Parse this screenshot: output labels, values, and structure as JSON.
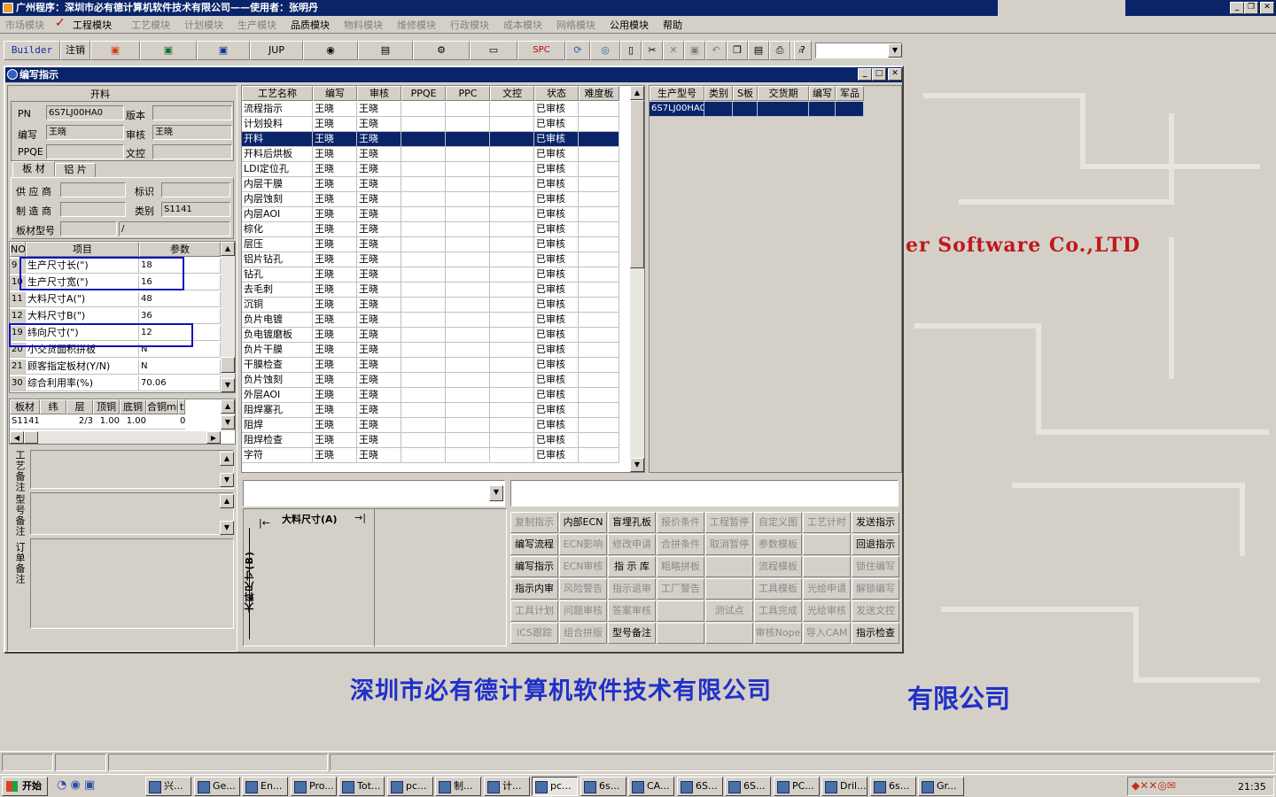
{
  "app": {
    "title": "广州程序：深圳市必有德计算机软件技术有限公司——使用者：张明丹"
  },
  "menu": [
    "市场模块",
    "工程模块",
    "工艺模块",
    "计划模块",
    "生产模块",
    "品质模块",
    "物料模块",
    "维修模块",
    "行政模块",
    "成本模块",
    "网络模块",
    "公用模块",
    "帮助"
  ],
  "toolbar": {
    "builder": "Builder",
    "logout": "注销",
    "jup": "JUP",
    "spc": "SPC"
  },
  "desktop": {
    "banner_red": "er Software Co.,LTD",
    "banner_blue": "深圳市必有德计算机软件技术有限公司",
    "banner_blue2": "有限公司"
  },
  "window": {
    "title": "编写指示"
  },
  "left": {
    "process_name": "开料",
    "pn_label": "PN",
    "pn_value": "6S7LJ00HA0",
    "version_label": "版本",
    "version_value": "",
    "writer_label": "编写",
    "writer_value": "王晓",
    "reviewer_label": "审核",
    "reviewer_value": "王晓",
    "ppqe_label": "PPQE",
    "ppqe_value": "",
    "doc_label": "文控",
    "doc_value": "",
    "tab_board": "板 材",
    "tab_foil": "铝 片",
    "supplier_label": "供 应 商",
    "supplier_value": "",
    "mark_label": "标识",
    "mark_value": "",
    "maker_label": "制 造 商",
    "maker_value": "",
    "type_label": "类别",
    "type_value": "S1141",
    "model_label": "板材型号",
    "model_value": "",
    "model_value2": "/",
    "params_headers": [
      "NO",
      "项目",
      "参数"
    ],
    "params": [
      {
        "no": "9",
        "item": "生产尺寸长(\")",
        "val": "18"
      },
      {
        "no": "10",
        "item": "生产尺寸宽(\")",
        "val": "16"
      },
      {
        "no": "11",
        "item": "大料尺寸A(\")",
        "val": "48"
      },
      {
        "no": "12",
        "item": "大料尺寸B(\")",
        "val": "36"
      },
      {
        "no": "19",
        "item": "纬向尺寸(\")",
        "val": "12"
      },
      {
        "no": "20",
        "item": "小交货面积拼板",
        "val": "N"
      },
      {
        "no": "21",
        "item": "顾客指定板材(Y/N)",
        "val": "N"
      },
      {
        "no": "30",
        "item": "综合利用率(%)",
        "val": "70.06"
      }
    ],
    "mat_headers": [
      "板材",
      "纬",
      "层",
      "顶铜",
      "底铜",
      "合铜mm",
      "t"
    ],
    "mat_row": [
      "S1141",
      "",
      "2/3",
      "1.00",
      "1.00",
      "",
      "0"
    ],
    "note1": "工艺备注",
    "note2": "型号备注",
    "note3": "订单备注"
  },
  "process": {
    "headers": [
      "工艺名称",
      "编写",
      "审核",
      "PPQE",
      "PPC",
      "文控",
      "状态",
      "难度板"
    ],
    "rows": [
      [
        "流程指示",
        "王晓",
        "王晓",
        "",
        "",
        "",
        "已审核",
        ""
      ],
      [
        "计划投料",
        "王晓",
        "王晓",
        "",
        "",
        "",
        "已审核",
        ""
      ],
      [
        "开料",
        "王晓",
        "王晓",
        "",
        "",
        "",
        "已审核",
        ""
      ],
      [
        "开料后烘板",
        "王晓",
        "王晓",
        "",
        "",
        "",
        "已审核",
        ""
      ],
      [
        "LDI定位孔",
        "王晓",
        "王晓",
        "",
        "",
        "",
        "已审核",
        ""
      ],
      [
        "内层干膜",
        "王晓",
        "王晓",
        "",
        "",
        "",
        "已审核",
        ""
      ],
      [
        "内层蚀刻",
        "王晓",
        "王晓",
        "",
        "",
        "",
        "已审核",
        ""
      ],
      [
        "内层AOI",
        "王晓",
        "王晓",
        "",
        "",
        "",
        "已审核",
        ""
      ],
      [
        "棕化",
        "王晓",
        "王晓",
        "",
        "",
        "",
        "已审核",
        ""
      ],
      [
        "层压",
        "王晓",
        "王晓",
        "",
        "",
        "",
        "已审核",
        ""
      ],
      [
        "铝片钻孔",
        "王晓",
        "王晓",
        "",
        "",
        "",
        "已审核",
        ""
      ],
      [
        "钻孔",
        "王晓",
        "王晓",
        "",
        "",
        "",
        "已审核",
        ""
      ],
      [
        "去毛刺",
        "王晓",
        "王晓",
        "",
        "",
        "",
        "已审核",
        ""
      ],
      [
        "沉铜",
        "王晓",
        "王晓",
        "",
        "",
        "",
        "已审核",
        ""
      ],
      [
        "负片电镀",
        "王晓",
        "王晓",
        "",
        "",
        "",
        "已审核",
        ""
      ],
      [
        "负电镀磨板",
        "王晓",
        "王晓",
        "",
        "",
        "",
        "已审核",
        ""
      ],
      [
        "负片干膜",
        "王晓",
        "王晓",
        "",
        "",
        "",
        "已审核",
        ""
      ],
      [
        "干膜检查",
        "王晓",
        "王晓",
        "",
        "",
        "",
        "已审核",
        ""
      ],
      [
        "负片蚀刻",
        "王晓",
        "王晓",
        "",
        "",
        "",
        "已审核",
        ""
      ],
      [
        "外层AOI",
        "王晓",
        "王晓",
        "",
        "",
        "",
        "已审核",
        ""
      ],
      [
        "阻焊塞孔",
        "王晓",
        "王晓",
        "",
        "",
        "",
        "已审核",
        ""
      ],
      [
        "阻焊",
        "王晓",
        "王晓",
        "",
        "",
        "",
        "已审核",
        ""
      ],
      [
        "阻焊检查",
        "王晓",
        "王晓",
        "",
        "",
        "",
        "已审核",
        ""
      ],
      [
        "字符",
        "王晓",
        "王晓",
        "",
        "",
        "",
        "已审核",
        ""
      ]
    ],
    "selected": 2
  },
  "right": {
    "headers": [
      "生产型号",
      "类别",
      "S板",
      "交货期",
      "编写",
      "军品"
    ],
    "row": [
      "6S7LJ00HA0",
      "",
      "",
      "",
      "",
      ""
    ]
  },
  "diagram": {
    "a_label": "大料尺寸(A)",
    "b_label": "大料尺寸(B)"
  },
  "actions": [
    [
      {
        "t": "复制指示",
        "d": true
      },
      {
        "t": "内部ECN",
        "d": false
      },
      {
        "t": "盲埋孔板",
        "d": false
      },
      {
        "t": "报价条件",
        "d": true
      },
      {
        "t": "工程暂停",
        "d": true
      },
      {
        "t": "自定义图",
        "d": true
      },
      {
        "t": "工艺计时",
        "d": true
      },
      {
        "t": "发送指示",
        "d": false
      }
    ],
    [
      {
        "t": "编写流程",
        "d": false
      },
      {
        "t": "ECN影响",
        "d": true
      },
      {
        "t": "修改申请",
        "d": true
      },
      {
        "t": "合拼条件",
        "d": true
      },
      {
        "t": "取消暂停",
        "d": true
      },
      {
        "t": "参数模板",
        "d": true
      },
      {
        "t": "",
        "d": true
      },
      {
        "t": "回退指示",
        "d": false
      }
    ],
    [
      {
        "t": "编写指示",
        "d": false
      },
      {
        "t": "ECN审核",
        "d": true
      },
      {
        "t": "指 示 库",
        "d": false
      },
      {
        "t": "粗略拼板",
        "d": true
      },
      {
        "t": "",
        "d": true
      },
      {
        "t": "流程模板",
        "d": true
      },
      {
        "t": "",
        "d": true
      },
      {
        "t": "锁住编写",
        "d": true
      }
    ],
    [
      {
        "t": "指示内审",
        "d": false
      },
      {
        "t": "风险警告",
        "d": true
      },
      {
        "t": "指示退审",
        "d": true
      },
      {
        "t": "工厂警告",
        "d": true
      },
      {
        "t": "",
        "d": true
      },
      {
        "t": "工具模板",
        "d": true
      },
      {
        "t": "光绘申请",
        "d": true
      },
      {
        "t": "解锁编写",
        "d": true
      }
    ],
    [
      {
        "t": "工具计划",
        "d": true
      },
      {
        "t": "问题审核",
        "d": true
      },
      {
        "t": "答案审核",
        "d": true
      },
      {
        "t": "",
        "d": true
      },
      {
        "t": "测试点",
        "d": true
      },
      {
        "t": "工具完成",
        "d": true
      },
      {
        "t": "光绘审核",
        "d": true
      },
      {
        "t": "发送文控",
        "d": true
      }
    ],
    [
      {
        "t": "ICS跟踪",
        "d": true
      },
      {
        "t": "组合拼版",
        "d": true
      },
      {
        "t": "型号备注",
        "d": false
      },
      {
        "t": "",
        "d": true
      },
      {
        "t": "",
        "d": true
      },
      {
        "t": "审核Nope",
        "d": true
      },
      {
        "t": "导入CAM",
        "d": true
      },
      {
        "t": "指示检查",
        "d": false
      }
    ]
  ],
  "taskbar": {
    "start": "开始",
    "tasks": [
      "兴...",
      "Ge...",
      "En...",
      "Pro...",
      "Tot...",
      "pc...",
      "制...",
      "计...",
      "pc...",
      "6s...",
      "CA...",
      "6S...",
      "6S...",
      "PC...",
      "Dril...",
      "6s...",
      "Gr..."
    ],
    "clock": "21:35"
  }
}
